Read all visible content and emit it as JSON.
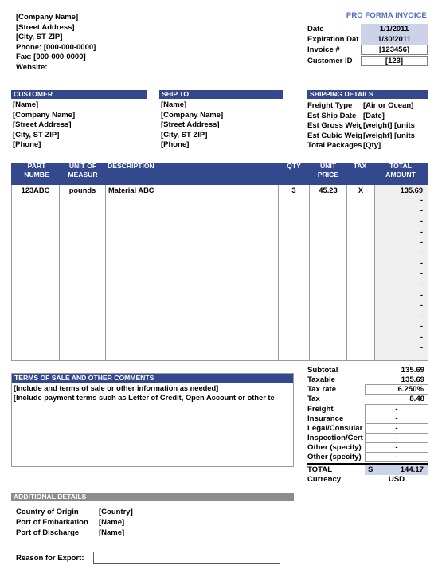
{
  "document": {
    "type": "pro-forma-invoice",
    "title": "PRO FORMA INVOICE"
  },
  "colors": {
    "header_blue": "#34488e",
    "header_gray": "#8c8c8c",
    "title_blue": "#4f6fb5",
    "fill_blue": "#ccd3e8",
    "amount_gray": "#efefef"
  },
  "company": {
    "lines": [
      "[Company Name]",
      "[Street Address]",
      "[City, ST  ZIP]",
      "Phone: [000-000-0000]",
      "Fax: [000-000-0000]",
      "Website:"
    ]
  },
  "invoice_meta": {
    "rows": [
      {
        "label": "Date",
        "value": "1/1/2011",
        "style": "fill"
      },
      {
        "label": "Expiration Dat",
        "value": "1/30/2011",
        "style": "fill"
      },
      {
        "label": "Invoice #",
        "value": "[123456]",
        "style": "boxed"
      },
      {
        "label": "Customer ID",
        "value": "[123]",
        "style": "boxed"
      }
    ]
  },
  "customer": {
    "heading": "CUSTOMER",
    "lines": [
      "[Name]",
      "[Company Name]",
      "[Street Address]",
      "[City, ST  ZIP]",
      "[Phone]"
    ]
  },
  "ship_to": {
    "heading": "SHIP TO",
    "lines": [
      "[Name]",
      "[Company Name]",
      "[Street Address]",
      "[City, ST  ZIP]",
      "[Phone]"
    ]
  },
  "shipping_details": {
    "heading": "SHIPPING DETAILS",
    "rows": [
      {
        "label": "Freight Type",
        "value": "[Air or Ocean]"
      },
      {
        "label": "Est Ship Date",
        "value": "[Date]"
      },
      {
        "label": "Est Gross Weigl",
        "value": "[weight] [units"
      },
      {
        "label": "Est Cubic Weigl",
        "value": "[weight] [units"
      },
      {
        "label": "Total Packages",
        "value": "[Qty]"
      }
    ]
  },
  "items_table": {
    "columns": [
      {
        "line1": "PART",
        "line2": "NUMBE"
      },
      {
        "line1": "UNIT OF",
        "line2": "MEASUR"
      },
      {
        "line1": "",
        "line2": "DESCRIPTION"
      },
      {
        "line1": "",
        "line2": "QTY"
      },
      {
        "line1": "UNIT",
        "line2": "PRICE"
      },
      {
        "line1": "",
        "line2": "TAX"
      },
      {
        "line1": "TOTAL",
        "line2": "AMOUNT"
      }
    ],
    "rows": [
      {
        "part_number": "123ABC",
        "unit_of_measure": "pounds",
        "description": "Material ABC",
        "qty": "3",
        "unit_price": "45.23",
        "tax": "X",
        "total_amount": "135.69"
      }
    ],
    "empty_amount_placeholder": "-",
    "empty_row_count": 15
  },
  "terms": {
    "heading": "TERMS OF SALE AND OTHER COMMENTS",
    "lines": [
      "[Include and terms of sale or other information as needed]",
      "[Include payment terms such as Letter of Credit, Open Account or other te"
    ]
  },
  "totals": {
    "rows": [
      {
        "label": "Subtotal",
        "value": "135.69",
        "style": "plain"
      },
      {
        "label": "Taxable",
        "value": "135.69",
        "style": "plain"
      },
      {
        "label": "Tax rate",
        "value": "6.250%",
        "style": "boxed"
      },
      {
        "label": "Tax",
        "value": "8.48",
        "style": "plain"
      },
      {
        "label": "Freight",
        "value": "-",
        "style": "boxed-dash"
      },
      {
        "label": "Insurance",
        "value": "-",
        "style": "boxed-dash"
      },
      {
        "label": "Legal/Consular",
        "value": "-",
        "style": "boxed-dash"
      },
      {
        "label": "Inspection/Cert",
        "value": "-",
        "style": "boxed-dash"
      },
      {
        "label": "Other (specify)",
        "value": "-",
        "style": "boxed-dash"
      },
      {
        "label": "Other (specify)",
        "value": "-",
        "style": "boxed-dash"
      }
    ],
    "total": {
      "label": "TOTAL",
      "symbol": "S",
      "value": "144.17"
    },
    "currency": {
      "label": "Currency",
      "value": "USD"
    }
  },
  "additional_details": {
    "heading": "ADDITIONAL DETAILS",
    "rows": [
      {
        "label": "Country of Origin",
        "value": "[Country]"
      },
      {
        "label": "Port of Embarkation",
        "value": "[Name]"
      },
      {
        "label": "Port of Discharge",
        "value": "[Name]"
      }
    ],
    "reason_for_export": {
      "label": "Reason for Export:",
      "value": ""
    }
  }
}
